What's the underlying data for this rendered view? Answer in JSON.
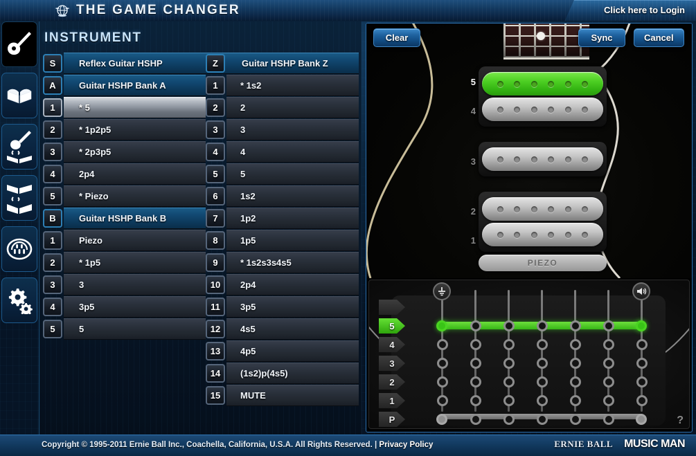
{
  "header": {
    "title": "THE GAME CHANGER",
    "logo_icon": "winged-globe-icon",
    "login_label": "Click here to Login"
  },
  "sidebar": {
    "items": [
      {
        "name": "instrument",
        "icon": "guitar-icon",
        "active": true
      },
      {
        "name": "library",
        "icon": "book-icon",
        "active": false
      },
      {
        "name": "guitar-to-library",
        "icon": "guitar-book-sync-icon",
        "active": false
      },
      {
        "name": "library-to-library",
        "icon": "book-book-sync-icon",
        "active": false
      },
      {
        "name": "midi",
        "icon": "midi-din-icon",
        "active": false
      },
      {
        "name": "settings",
        "icon": "gears-icon",
        "active": false
      }
    ]
  },
  "left_panel": {
    "title": "INSTRUMENT",
    "column_a": [
      {
        "badge": "S",
        "label": "Reflex Guitar HSHP",
        "kind": "header",
        "wide": true
      },
      {
        "badge": "A",
        "label": "Guitar HSHP Bank A",
        "kind": "header"
      },
      {
        "badge": "1",
        "label": "* 5",
        "kind": "item",
        "selected": true,
        "icon": "music-note-icon"
      },
      {
        "badge": "2",
        "label": "* 1p2p5",
        "kind": "item"
      },
      {
        "badge": "3",
        "label": "* 2p3p5",
        "kind": "item"
      },
      {
        "badge": "4",
        "label": "2p4",
        "kind": "item"
      },
      {
        "badge": "5",
        "label": "* Piezo",
        "kind": "item"
      },
      {
        "badge": "B",
        "label": "Guitar HSHP Bank B",
        "kind": "header"
      },
      {
        "badge": "1",
        "label": "Piezo",
        "kind": "item"
      },
      {
        "badge": "2",
        "label": "* 1p5",
        "kind": "item"
      },
      {
        "badge": "3",
        "label": "3",
        "kind": "item"
      },
      {
        "badge": "4",
        "label": "3p5",
        "kind": "item"
      },
      {
        "badge": "5",
        "label": "5",
        "kind": "item"
      }
    ],
    "column_z": [
      {
        "badge": "Z",
        "label": "Guitar HSHP Bank Z",
        "kind": "header"
      },
      {
        "badge": "1",
        "label": "* 1s2",
        "kind": "item"
      },
      {
        "badge": "2",
        "label": "2",
        "kind": "item"
      },
      {
        "badge": "3",
        "label": "3",
        "kind": "item"
      },
      {
        "badge": "4",
        "label": "4",
        "kind": "item"
      },
      {
        "badge": "5",
        "label": "5",
        "kind": "item"
      },
      {
        "badge": "6",
        "label": "1s2",
        "kind": "item"
      },
      {
        "badge": "7",
        "label": "1p2",
        "kind": "item"
      },
      {
        "badge": "8",
        "label": "1p5",
        "kind": "item"
      },
      {
        "badge": "9",
        "label": "* 1s2s3s4s5",
        "kind": "item"
      },
      {
        "badge": "10",
        "label": "2p4",
        "kind": "item"
      },
      {
        "badge": "11",
        "label": "3p5",
        "kind": "item"
      },
      {
        "badge": "12",
        "label": "4s5",
        "kind": "item"
      },
      {
        "badge": "13",
        "label": "4p5",
        "kind": "item"
      },
      {
        "badge": "14",
        "label": "(1s2)p(4s5)",
        "kind": "item"
      },
      {
        "badge": "15",
        "label": "MUTE",
        "kind": "item"
      }
    ]
  },
  "right_panel": {
    "buttons": {
      "clear": "Clear",
      "sync": "Sync",
      "cancel": "Cancel"
    },
    "pickups": [
      {
        "label": "5",
        "active": true,
        "poles": 6
      },
      {
        "label": "4",
        "active": false,
        "poles": 6
      },
      {
        "label": "3",
        "active": false,
        "poles": 6
      },
      {
        "label": "2",
        "active": false,
        "poles": 6
      },
      {
        "label": "1",
        "active": false,
        "poles": 6
      },
      {
        "label": "PIEZO",
        "active": false,
        "piezo": true
      }
    ],
    "matrix": {
      "ground_icon": "ground-icon",
      "output_icon": "speaker-icon",
      "help_label": "?",
      "columns": 7,
      "rows": [
        {
          "label": "",
          "active": false,
          "connected": false
        },
        {
          "label": "5",
          "active": true,
          "connected": true
        },
        {
          "label": "4",
          "active": false,
          "connected": false
        },
        {
          "label": "3",
          "active": false,
          "connected": false
        },
        {
          "label": "2",
          "active": false,
          "connected": false
        },
        {
          "label": "1",
          "active": false,
          "connected": false
        },
        {
          "label": "P",
          "active": false,
          "connected": "gray"
        }
      ]
    }
  },
  "footer": {
    "copyright": "Copyright © 1995-2011 Ernie Ball Inc., Coachella, California, U.S.A. All Rights Reserved. |",
    "privacy_label": "Privacy Policy",
    "logo_ernie_ball": "ERNIE BALL",
    "logo_music_man": "MUSIC MAN"
  },
  "colors": {
    "accent_blue": "#2a6faf",
    "active_green": "#4ed024",
    "header_blue": "#13395f",
    "panel_dark": "#081b2e"
  }
}
